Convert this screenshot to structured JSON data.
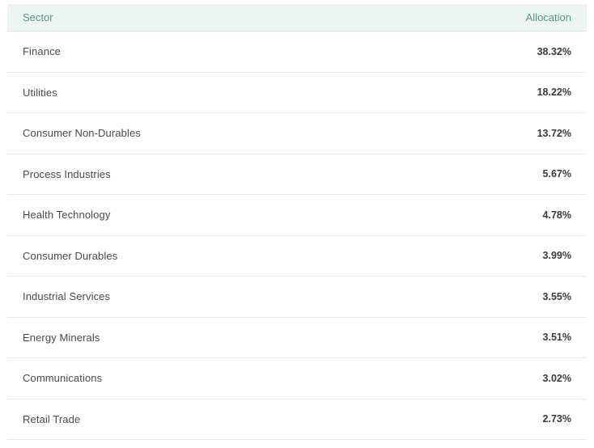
{
  "table": {
    "headers": {
      "sector": "Sector",
      "allocation": "Allocation"
    },
    "rows": [
      {
        "sector": "Finance",
        "allocation": "38.32%"
      },
      {
        "sector": "Utilities",
        "allocation": "18.22%"
      },
      {
        "sector": "Consumer Non-Durables",
        "allocation": "13.72%"
      },
      {
        "sector": "Process Industries",
        "allocation": "5.67%"
      },
      {
        "sector": "Health Technology",
        "allocation": "4.78%"
      },
      {
        "sector": "Consumer Durables",
        "allocation": "3.99%"
      },
      {
        "sector": "Industrial Services",
        "allocation": "3.55%"
      },
      {
        "sector": "Energy Minerals",
        "allocation": "3.51%"
      },
      {
        "sector": "Communications",
        "allocation": "3.02%"
      },
      {
        "sector": "Retail Trade",
        "allocation": "2.73%"
      }
    ]
  },
  "colors": {
    "header_bg": "#edf5f2",
    "header_text": "#4f9b82",
    "row_text": "#4a4a4a",
    "value_text": "#3b3b3b",
    "divider": "#e6e6e6"
  }
}
